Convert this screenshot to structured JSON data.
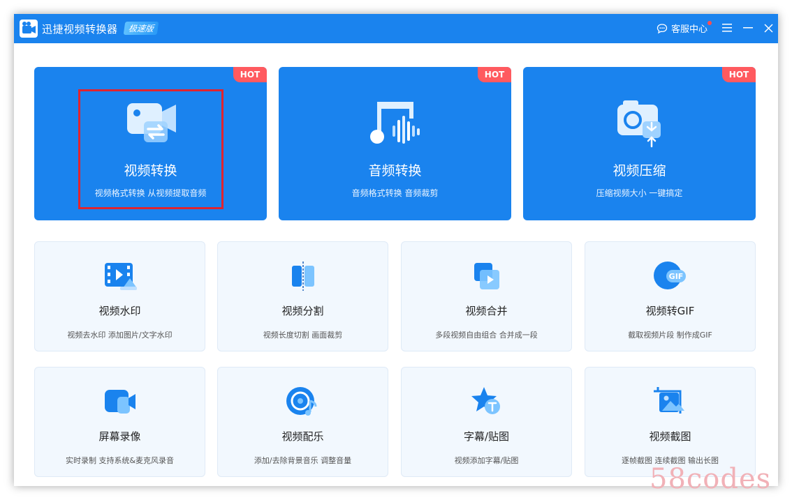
{
  "titlebar": {
    "app_title": "迅捷视频转换器",
    "edition_badge": "极速版",
    "support_label": "客服中心"
  },
  "big_cards": [
    {
      "title": "视频转换",
      "subtitle": "视频格式转换 从视频提取音频",
      "badge": "HOT",
      "icon": "video-convert-icon"
    },
    {
      "title": "音频转换",
      "subtitle": "音频格式转换 音频裁剪",
      "badge": "HOT",
      "icon": "audio-convert-icon"
    },
    {
      "title": "视频压缩",
      "subtitle": "压缩视频大小 一键搞定",
      "badge": "HOT",
      "icon": "video-compress-icon"
    }
  ],
  "small_cards": [
    {
      "title": "视频水印",
      "subtitle": "视频去水印 添加图片/文字水印",
      "icon": "video-watermark-icon"
    },
    {
      "title": "视频分割",
      "subtitle": "视频长度切割 画面裁剪",
      "icon": "video-split-icon"
    },
    {
      "title": "视频合并",
      "subtitle": "多段视频自由组合 合并成一段",
      "icon": "video-merge-icon"
    },
    {
      "title": "视频转GIF",
      "subtitle": "截取视频片段 制作成GIF",
      "icon": "video-to-gif-icon"
    },
    {
      "title": "屏幕录像",
      "subtitle": "实时录制 支持系统&麦克风录音",
      "icon": "screen-record-icon"
    },
    {
      "title": "视频配乐",
      "subtitle": "添加/去除背景音乐 调整音量",
      "icon": "video-music-icon"
    },
    {
      "title": "字幕/贴图",
      "subtitle": "视频添加字幕/贴图",
      "icon": "subtitle-sticker-icon"
    },
    {
      "title": "视频截图",
      "subtitle": "逐帧截图 连续截图 输出长图",
      "icon": "video-screenshot-icon"
    }
  ],
  "gif_icon_text": "GIF",
  "colors": {
    "accent": "#1a83ee",
    "hot_badge": "#ff5a5f",
    "highlight_box": "#e0242f",
    "small_card_bg": "#f2f8fe"
  },
  "watermark": "58codes"
}
